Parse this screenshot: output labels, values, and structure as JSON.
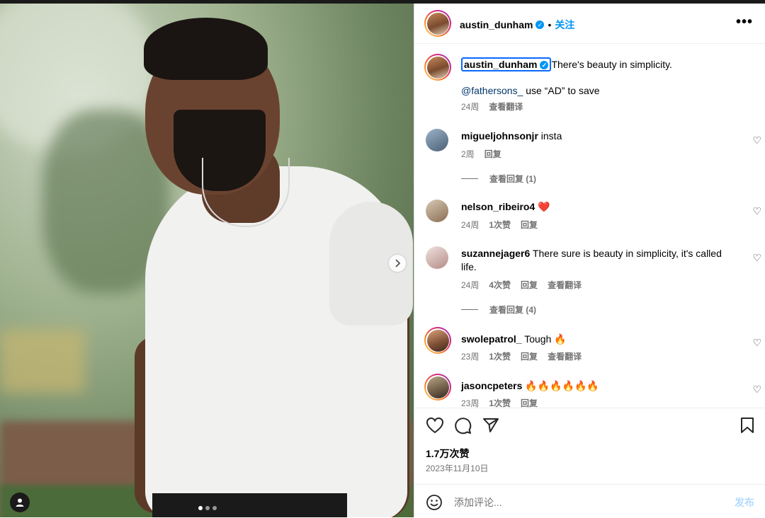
{
  "post": {
    "author": "austin_dunham",
    "verified_icon": "verified-badge-icon",
    "follow_label": "关注",
    "separator": "•",
    "more_label": "•••",
    "caption_text": "There's beauty in simplicity.",
    "caption_mention": "@fathersons_",
    "caption_rest": " use “AD” to save",
    "caption_age": "24周",
    "caption_translate": "查看翻译",
    "likes": "1.7万次赞",
    "date": "2023年11月10日",
    "comment_placeholder": "添加评论...",
    "post_label": "发布"
  },
  "comments": [
    {
      "user": "migueljohnsonjr",
      "text": "insta",
      "age": "2周",
      "likes": "",
      "reply": "回复",
      "translate": "",
      "view_replies": "查看回复 (1)"
    },
    {
      "user": "nelson_ribeiro4",
      "text": "❤️",
      "age": "24周",
      "likes": "1次赞",
      "reply": "回复",
      "translate": "",
      "view_replies": ""
    },
    {
      "user": "suzannejager6",
      "text": "There sure is beauty in simplicity, it's called life.",
      "age": "24周",
      "likes": "4次赞",
      "reply": "回复",
      "translate": "查看翻译",
      "view_replies": "查看回复 (4)"
    },
    {
      "user": "swolepatrol_",
      "text": "Tough 🔥",
      "age": "23周",
      "likes": "1次赞",
      "reply": "回复",
      "translate": "查看翻译",
      "view_replies": ""
    },
    {
      "user": "jasoncpeters",
      "text": "🔥🔥🔥🔥🔥🔥",
      "age": "23周",
      "likes": "1次赞",
      "reply": "回复",
      "translate": "",
      "view_replies": ""
    }
  ],
  "carousel": {
    "slides": 3,
    "current": 1
  },
  "icons": [
    "heart-icon",
    "comment-icon",
    "share-icon",
    "bookmark-icon",
    "emoji-icon",
    "next-arrow-icon",
    "user-tag-icon",
    "more-options-icon"
  ],
  "colors": {
    "accent": "#0095f6",
    "mention": "#00376b",
    "muted": "#737373",
    "post_disabled": "#b3dbff",
    "like_red": "#ed4956"
  }
}
